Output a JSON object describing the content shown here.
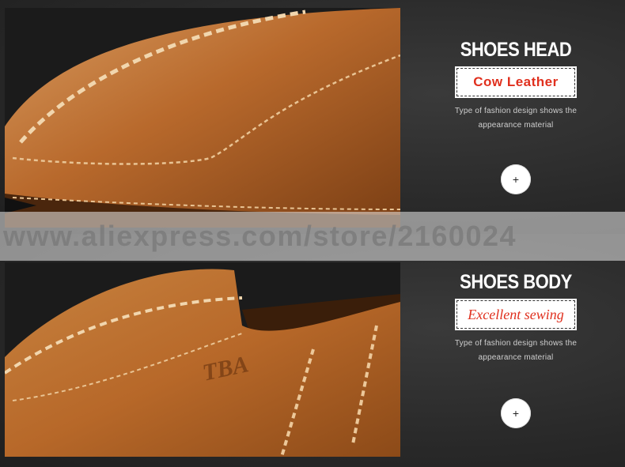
{
  "sections": [
    {
      "heading": "SHOES HEAD",
      "tag": "Cow Leather",
      "desc_line1": "Type of fashion design shows the",
      "desc_line2": "appearance material",
      "plus": "+"
    },
    {
      "heading": "SHOES BODY",
      "tag": "Excellent sewing",
      "desc_line1": "Type of fashion design shows the",
      "desc_line2": "appearance material",
      "plus": "+"
    }
  ],
  "photo_text": "TBA",
  "watermark": "www.aliexpress.com/store/2160024",
  "colors": {
    "tag_text": "#e0301e",
    "leather": "#b86a2e",
    "background": "#2b2b2b"
  }
}
